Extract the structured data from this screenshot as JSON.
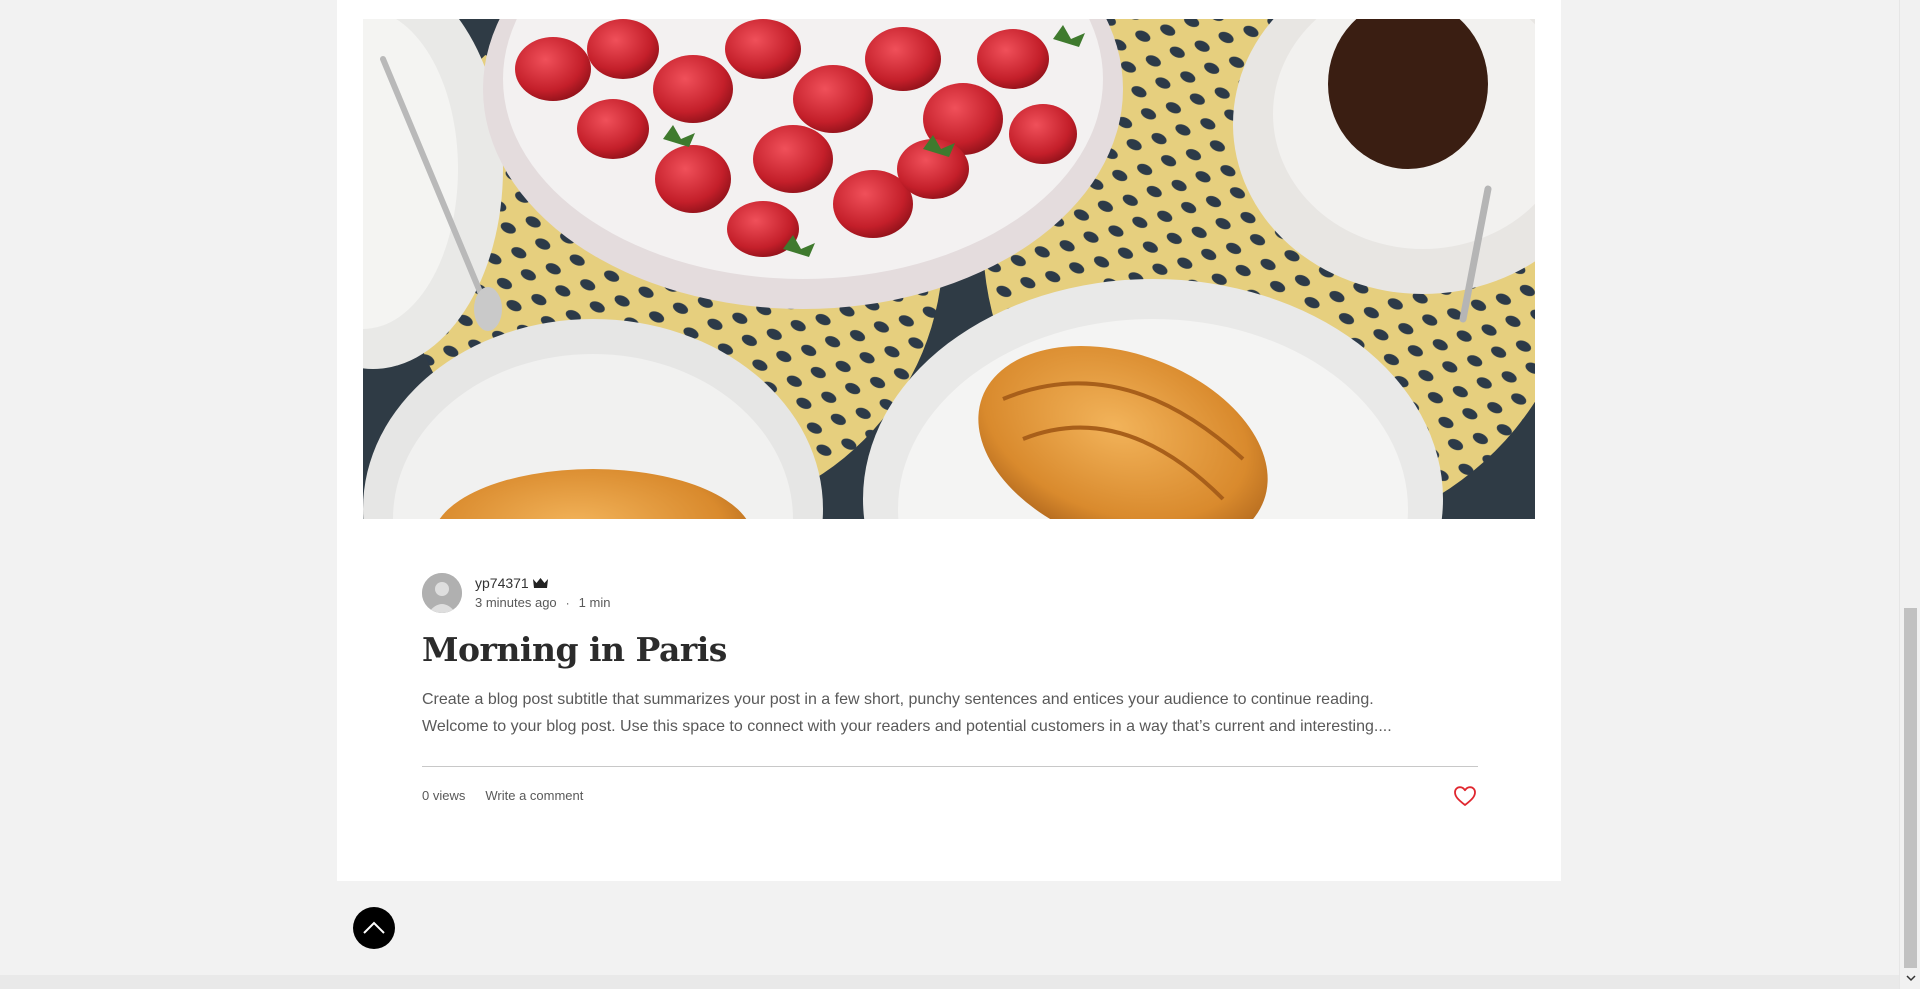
{
  "post": {
    "author": "yp74371",
    "time_ago": "3 minutes ago",
    "read_time": "1 min",
    "separator": "·",
    "title": "Morning in Paris",
    "excerpt_line1": "Create a blog post subtitle that summarizes your post in a few short, punchy sentences and entices your audience to continue reading.",
    "excerpt_line2": "Welcome to your blog post. Use this space to connect with your readers and potential customers in a way that’s current and interesting....",
    "views": "0 views",
    "comment_label": "Write a comment",
    "liked": false
  },
  "icons": {
    "author_badge": "crown-icon",
    "like": "heart-icon",
    "back_to_top": "chevron-up-icon",
    "scroll_down": "chevron-down-icon"
  },
  "colors": {
    "heart": "#e0272f",
    "page_bg": "#f2f2f2",
    "card_bg": "#ffffff",
    "title": "#2b2b2b",
    "text": "#595959"
  }
}
